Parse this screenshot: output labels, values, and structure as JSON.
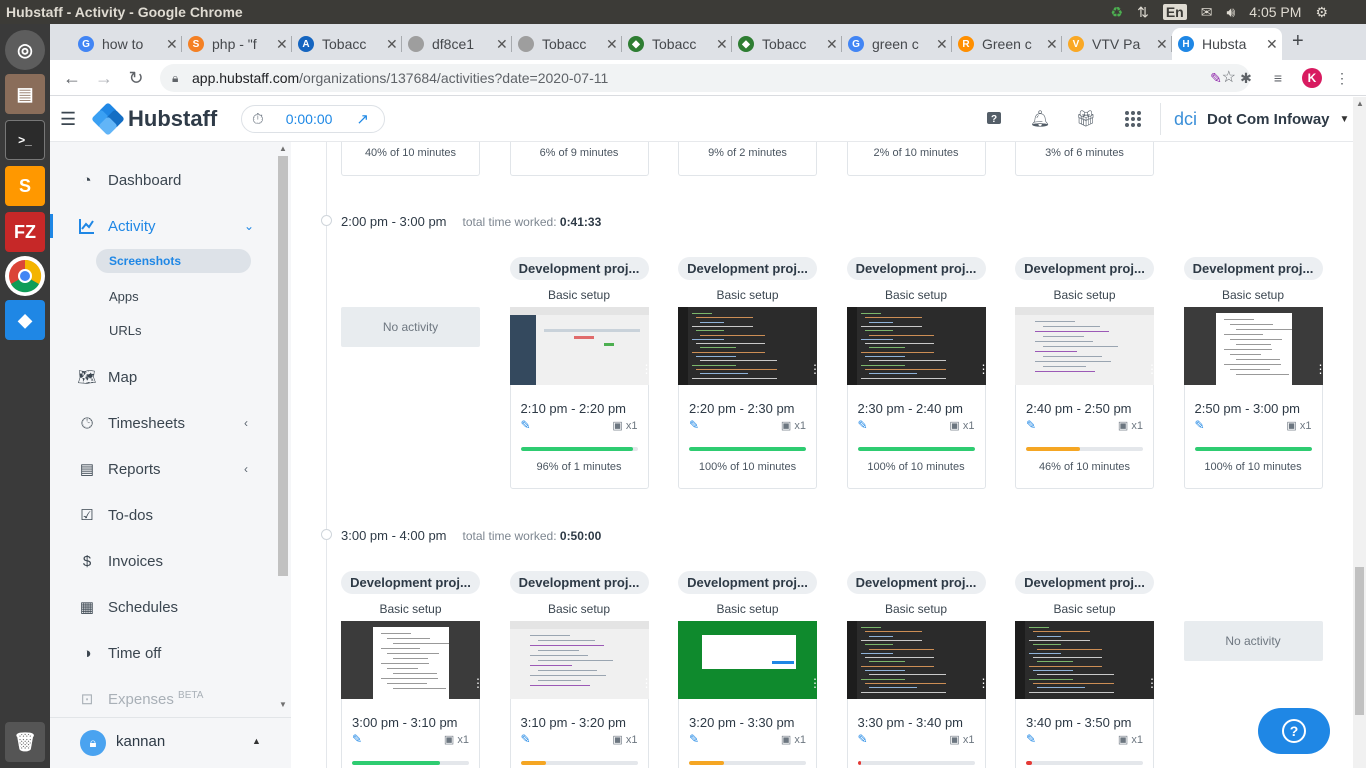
{
  "os": {
    "window_title": "Hubstaff - Activity - Google Chrome",
    "keyboard": "En",
    "clock": "4:05 PM"
  },
  "tabs": [
    {
      "label": "how to",
      "fav": "G",
      "color": "#4285f4"
    },
    {
      "label": "php - \"f",
      "fav": "S",
      "color": "#f48024"
    },
    {
      "label": "Tobacc",
      "fav": "A",
      "color": "#1565c0"
    },
    {
      "label": "df8ce1",
      "fav": "",
      "color": "#9e9e9e"
    },
    {
      "label": "Tobacc",
      "fav": "",
      "color": "#9e9e9e"
    },
    {
      "label": "Tobacc",
      "fav": "◆",
      "color": "#2e7d32"
    },
    {
      "label": "Tobacc",
      "fav": "◆",
      "color": "#2e7d32"
    },
    {
      "label": "green c",
      "fav": "G",
      "color": "#4285f4"
    },
    {
      "label": "Green c",
      "fav": "R",
      "color": "#ff8f00"
    },
    {
      "label": "VTV Pa",
      "fav": "V",
      "color": "#f9a825"
    },
    {
      "label": "Hubsta",
      "fav": "H",
      "color": "#1f87e5"
    }
  ],
  "address": {
    "host": "app.hubstaff.com",
    "path": "/organizations/137684/activities?date=2020-07-11",
    "profile_initial": "K"
  },
  "header": {
    "brand": "Hubstaff",
    "timer": "0:00:00",
    "org_logo": "dci",
    "org_name": "Dot Com Infoway"
  },
  "sidebar": {
    "items": [
      {
        "label": "Dashboard"
      },
      {
        "label": "Activity"
      },
      {
        "label": "Map"
      },
      {
        "label": "Timesheets"
      },
      {
        "label": "Reports"
      },
      {
        "label": "To-dos"
      },
      {
        "label": "Invoices"
      },
      {
        "label": "Schedules"
      },
      {
        "label": "Time off"
      },
      {
        "label": "Expenses",
        "badge": "BETA"
      }
    ],
    "sub_items": [
      "Screenshots",
      "Apps",
      "URLs"
    ],
    "user": "kannan"
  },
  "top_row": [
    "40% of 10 minutes",
    "6% of 9 minutes",
    "9% of 2 minutes",
    "2% of 10 minutes",
    "3% of 6 minutes"
  ],
  "hours": [
    {
      "range": "2:00 pm - 3:00 pm",
      "total_label": "total time worked:",
      "total": "0:41:33",
      "no_activity": "No activity",
      "cards": [
        {
          "project": "Development proj...",
          "task": "Basic setup",
          "time": "2:10 pm - 2:20 pm",
          "screens": "x1",
          "activity": 0.96,
          "color": "#2ecc71",
          "pct": "96% of 1 minutes"
        },
        {
          "project": "Development proj...",
          "task": "Basic setup",
          "time": "2:20 pm - 2:30 pm",
          "screens": "x1",
          "activity": 1.0,
          "color": "#2ecc71",
          "pct": "100% of 10 minutes"
        },
        {
          "project": "Development proj...",
          "task": "Basic setup",
          "time": "2:30 pm - 2:40 pm",
          "screens": "x1",
          "activity": 1.0,
          "color": "#2ecc71",
          "pct": "100% of 10 minutes"
        },
        {
          "project": "Development proj...",
          "task": "Basic setup",
          "time": "2:40 pm - 2:50 pm",
          "screens": "x1",
          "activity": 0.46,
          "color": "#f5a623",
          "pct": "46% of 10 minutes"
        },
        {
          "project": "Development proj...",
          "task": "Basic setup",
          "time": "2:50 pm - 3:00 pm",
          "screens": "x1",
          "activity": 1.0,
          "color": "#2ecc71",
          "pct": "100% of 10 minutes"
        }
      ]
    },
    {
      "range": "3:00 pm - 4:00 pm",
      "total_label": "total time worked:",
      "total": "0:50:00",
      "no_activity": "No activity",
      "cards": [
        {
          "project": "Development proj...",
          "task": "Basic setup",
          "time": "3:00 pm - 3:10 pm",
          "screens": "x1",
          "activity": 0.75,
          "color": "#2ecc71"
        },
        {
          "project": "Development proj...",
          "task": "Basic setup",
          "time": "3:10 pm - 3:20 pm",
          "screens": "x1",
          "activity": 0.22,
          "color": "#f5a623"
        },
        {
          "project": "Development proj...",
          "task": "Basic setup",
          "time": "3:20 pm - 3:30 pm",
          "screens": "x1",
          "activity": 0.3,
          "color": "#f5a623"
        },
        {
          "project": "Development proj...",
          "task": "Basic setup",
          "time": "3:30 pm - 3:40 pm",
          "screens": "x1",
          "activity": 0.03,
          "color": "#e53935"
        },
        {
          "project": "Development proj...",
          "task": "Basic setup",
          "time": "3:40 pm - 3:50 pm",
          "screens": "x1",
          "activity": 0.05,
          "color": "#e53935"
        }
      ]
    }
  ]
}
